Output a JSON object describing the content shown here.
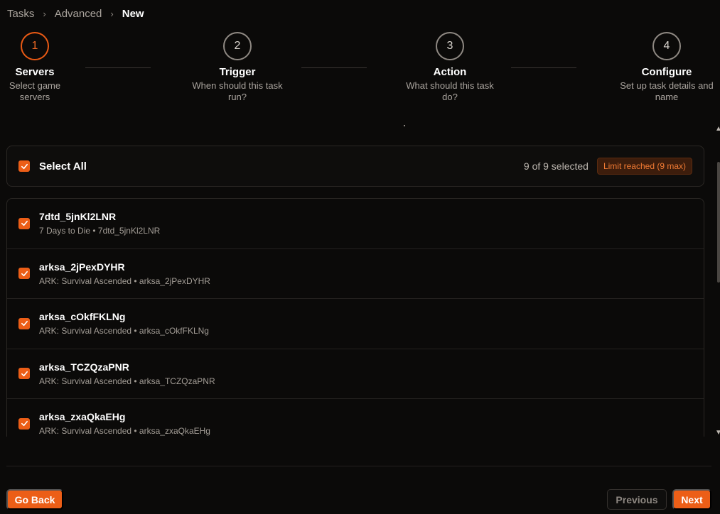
{
  "breadcrumb": {
    "items": [
      "Tasks",
      "Advanced"
    ],
    "current": "New",
    "separator": "›"
  },
  "steps": [
    {
      "number": "1",
      "title": "Servers",
      "desc_line1": "Select game",
      "desc_line2": "servers"
    },
    {
      "number": "2",
      "title": "Trigger",
      "desc_line1": "When should this task",
      "desc_line2": "run?"
    },
    {
      "number": "3",
      "title": "Action",
      "desc_line1": "What should this task",
      "desc_line2": "do?"
    },
    {
      "number": "4",
      "title": "Configure",
      "desc_line1": "Set up task details and",
      "desc_line2": "name"
    }
  ],
  "select_all": {
    "label": "Select All",
    "count": "9 of 9 selected",
    "badge": "Limit reached (9 max)",
    "checked": true
  },
  "servers": [
    {
      "name": "7dtd_5jnKl2LNR",
      "subtitle": "7 Days to Die • 7dtd_5jnKl2LNR",
      "checked": true
    },
    {
      "name": "arksa_2jPexDYHR",
      "subtitle": "ARK: Survival Ascended • arksa_2jPexDYHR",
      "checked": true
    },
    {
      "name": "arksa_cOkfFKLNg",
      "subtitle": "ARK: Survival Ascended • arksa_cOkfFKLNg",
      "checked": true
    },
    {
      "name": "arksa_TCZQzaPNR",
      "subtitle": "ARK: Survival Ascended • arksa_TCZQzaPNR",
      "checked": true
    },
    {
      "name": "arksa_zxaQkaEHg",
      "subtitle": "ARK: Survival Ascended • arksa_zxaQkaEHg",
      "checked": true
    }
  ],
  "footer": {
    "back_label": "Go Back",
    "previous_label": "Previous",
    "next_label": "Next"
  },
  "icons": {
    "checkbox": "check-icon",
    "separator": "chevron-right-icon"
  },
  "colors": {
    "accent": "#ec5e17",
    "background": "#0b0a09",
    "badge_bg": "#3d1d0c",
    "badge_text": "#f07a33"
  }
}
